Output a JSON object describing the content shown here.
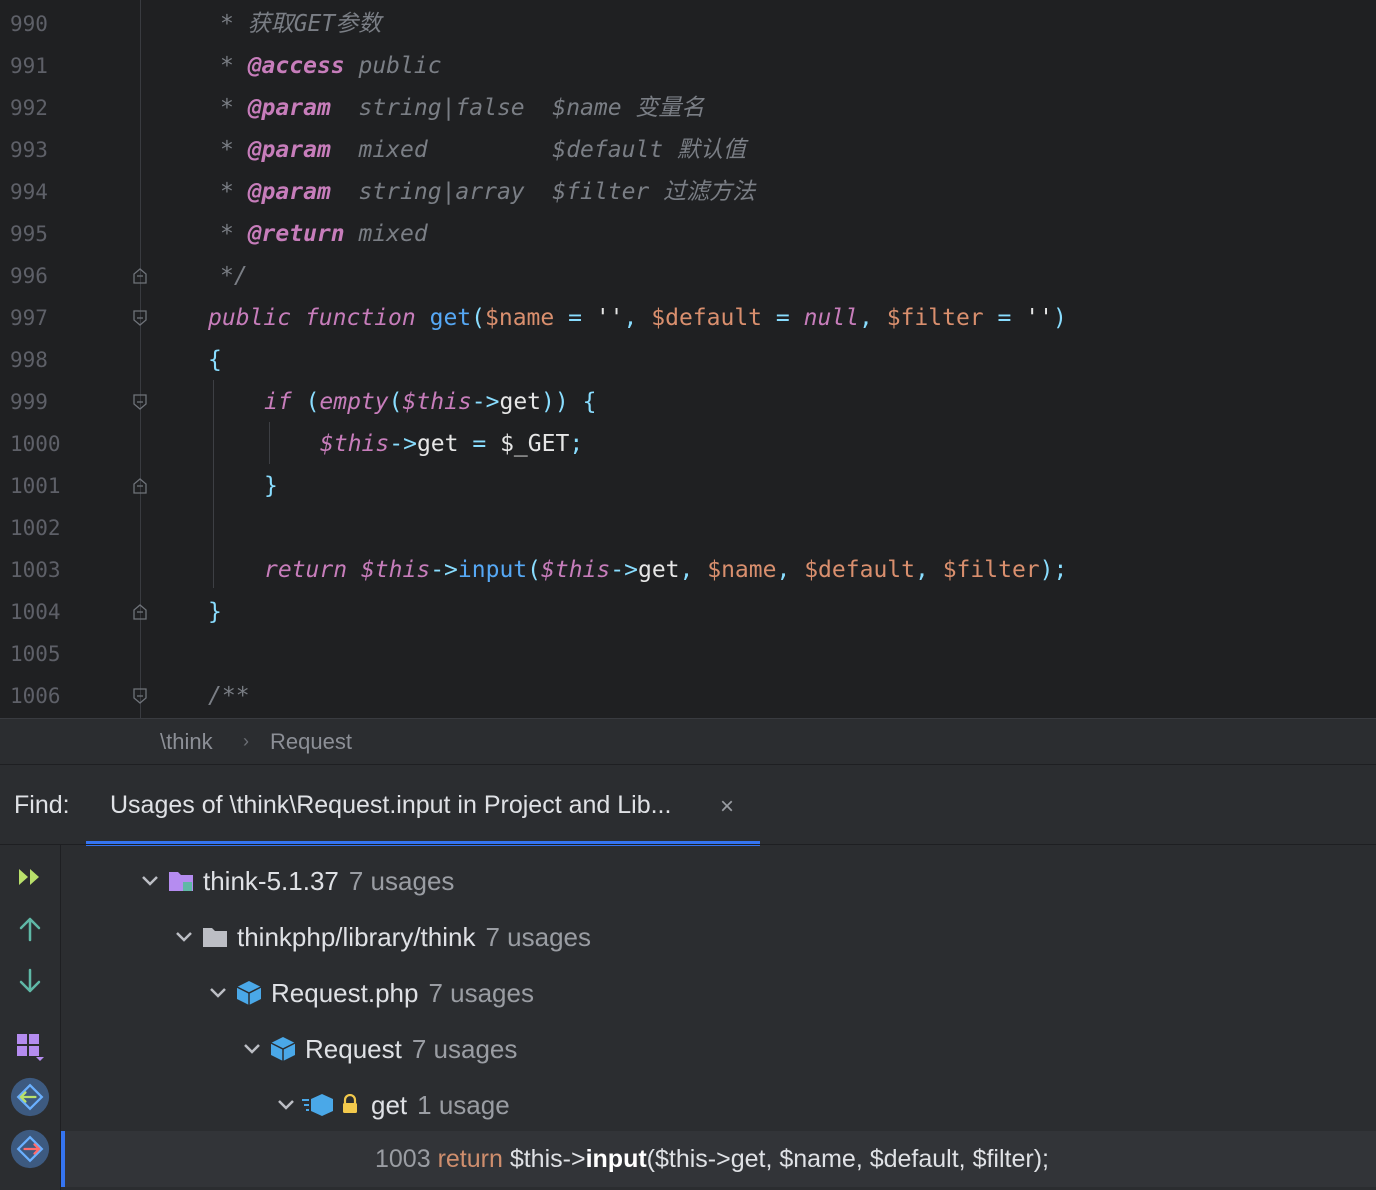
{
  "editor": {
    "lines": [
      {
        "num": "990",
        "tokens": [
          [
            "c-doc",
            "* 获取GET参数"
          ]
        ]
      },
      {
        "num": "991",
        "tokens": [
          [
            "c-doc",
            "* "
          ],
          [
            "c-tag",
            "@access"
          ],
          [
            "c-doc",
            " public"
          ]
        ]
      },
      {
        "num": "992",
        "tokens": [
          [
            "c-doc",
            "* "
          ],
          [
            "c-tag",
            "@param"
          ],
          [
            "c-doc",
            "  string|false  $name 变量名"
          ]
        ]
      },
      {
        "num": "993",
        "tokens": [
          [
            "c-doc",
            "* "
          ],
          [
            "c-tag",
            "@param"
          ],
          [
            "c-doc",
            "  mixed         $default 默认值"
          ]
        ]
      },
      {
        "num": "994",
        "tokens": [
          [
            "c-doc",
            "* "
          ],
          [
            "c-tag",
            "@param"
          ],
          [
            "c-doc",
            "  string|array  $filter 过滤方法"
          ]
        ]
      },
      {
        "num": "995",
        "tokens": [
          [
            "c-doc",
            "* "
          ],
          [
            "c-tag",
            "@return"
          ],
          [
            "c-doc",
            " mixed"
          ]
        ]
      },
      {
        "num": "996",
        "tokens": [
          [
            "c-doc",
            "*/"
          ]
        ]
      },
      {
        "num": "997",
        "tokens": [
          [
            "c-kw",
            "public"
          ],
          [
            "c-plain",
            " "
          ],
          [
            "c-kw",
            "function"
          ],
          [
            "c-plain",
            " "
          ],
          [
            "c-fn",
            "get"
          ],
          [
            "c-op",
            "("
          ],
          [
            "c-var",
            "$name"
          ],
          [
            "c-plain",
            " "
          ],
          [
            "c-op",
            "="
          ],
          [
            "c-plain",
            " "
          ],
          [
            "c-str",
            "''"
          ],
          [
            "c-op",
            ","
          ],
          [
            "c-plain",
            " "
          ],
          [
            "c-var",
            "$default"
          ],
          [
            "c-plain",
            " "
          ],
          [
            "c-op",
            "="
          ],
          [
            "c-plain",
            " "
          ],
          [
            "c-null",
            "null"
          ],
          [
            "c-op",
            ","
          ],
          [
            "c-plain",
            " "
          ],
          [
            "c-var",
            "$filter"
          ],
          [
            "c-plain",
            " "
          ],
          [
            "c-op",
            "="
          ],
          [
            "c-plain",
            " "
          ],
          [
            "c-str",
            "''"
          ],
          [
            "c-op",
            ")"
          ]
        ]
      },
      {
        "num": "998",
        "tokens": [
          [
            "c-op",
            "{"
          ]
        ]
      },
      {
        "num": "999",
        "tokens": [
          [
            "c-kw",
            "if"
          ],
          [
            "c-plain",
            " "
          ],
          [
            "c-op",
            "("
          ],
          [
            "c-ital",
            "empty"
          ],
          [
            "c-op",
            "("
          ],
          [
            "c-this",
            "$this"
          ],
          [
            "c-op",
            "->"
          ],
          [
            "c-plain",
            "get"
          ],
          [
            "c-op",
            "))"
          ],
          [
            "c-plain",
            " "
          ],
          [
            "c-op",
            "{"
          ]
        ]
      },
      {
        "num": "1000",
        "tokens": [
          [
            "c-this",
            "$this"
          ],
          [
            "c-op",
            "->"
          ],
          [
            "c-plain",
            "get"
          ],
          [
            "c-plain",
            " "
          ],
          [
            "c-op",
            "="
          ],
          [
            "c-plain",
            " $_GET"
          ],
          [
            "c-op",
            ";"
          ]
        ]
      },
      {
        "num": "1001",
        "tokens": [
          [
            "c-op",
            "}"
          ]
        ]
      },
      {
        "num": "1002",
        "tokens": []
      },
      {
        "num": "1003",
        "tokens": [
          [
            "c-kw",
            "return"
          ],
          [
            "c-plain",
            " "
          ],
          [
            "c-this",
            "$this"
          ],
          [
            "c-op",
            "->"
          ],
          [
            "c-fn",
            "input"
          ],
          [
            "c-op",
            "("
          ],
          [
            "c-this",
            "$this"
          ],
          [
            "c-op",
            "->"
          ],
          [
            "c-plain",
            "get"
          ],
          [
            "c-op",
            ","
          ],
          [
            "c-plain",
            " "
          ],
          [
            "c-var",
            "$name"
          ],
          [
            "c-op",
            ","
          ],
          [
            "c-plain",
            " "
          ],
          [
            "c-var",
            "$default"
          ],
          [
            "c-op",
            ","
          ],
          [
            "c-plain",
            " "
          ],
          [
            "c-var",
            "$filter"
          ],
          [
            "c-op",
            ");"
          ]
        ]
      },
      {
        "num": "1004",
        "tokens": [
          [
            "c-op",
            "}"
          ]
        ]
      },
      {
        "num": "1005",
        "tokens": []
      },
      {
        "num": "1006",
        "tokens": [
          [
            "c-doc",
            "/**"
          ]
        ]
      }
    ]
  },
  "breadcrumb": {
    "items": [
      "\\think",
      "Request"
    ],
    "separator": "›"
  },
  "find": {
    "label": "Find:",
    "tab_title": "Usages of \\think\\Request.input in Project and Lib...",
    "close": "×"
  },
  "toolbar": {
    "icons": [
      "expand-all-icon",
      "previous-occurrence-icon",
      "next-occurrence-icon",
      "group-by-icon",
      "navigate-back-icon",
      "navigate-forward-icon"
    ]
  },
  "tree": {
    "nodes": [
      {
        "name": "think-5.1.37",
        "count": "7 usages",
        "icon": "library-folder-icon"
      },
      {
        "name": "thinkphp/library/think",
        "count": "7 usages",
        "icon": "folder-icon"
      },
      {
        "name": "Request.php",
        "count": "7 usages",
        "icon": "php-class-file-icon"
      },
      {
        "name": "Request",
        "count": "7 usages",
        "icon": "class-icon"
      },
      {
        "name": "get",
        "count": "1 usage",
        "icon": "method-icon"
      }
    ],
    "result": {
      "line": "1003",
      "kw": "return",
      "pre": " $this->",
      "match": "input",
      "post": "($this->get, $name, $default, $filter);"
    }
  },
  "colors": {
    "accent": "#3574f0",
    "editor_bg": "#1f2022",
    "panel_bg": "#2b2d30"
  }
}
